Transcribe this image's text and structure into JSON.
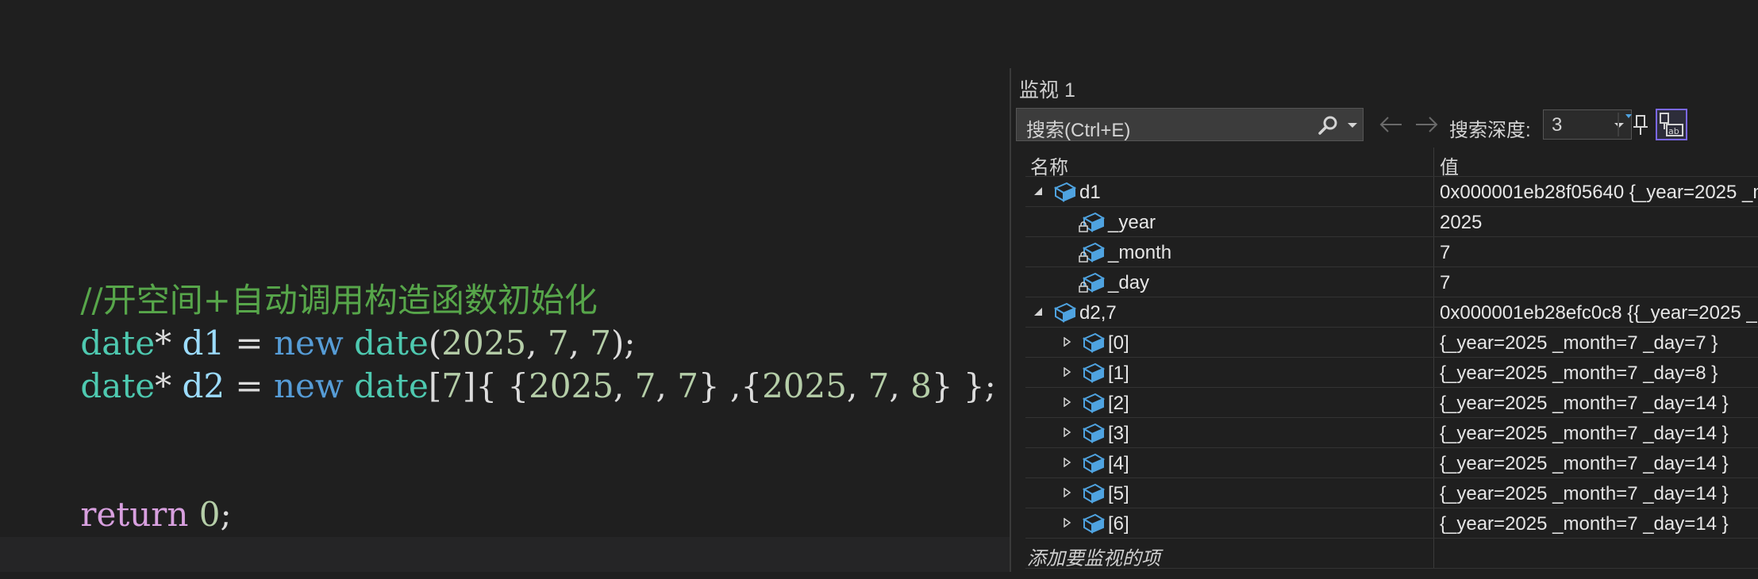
{
  "editor": {
    "line1": {
      "text": "//开空间+自动调用构造函数初始化"
    },
    "line2": {
      "t1": "date",
      "t2": "* ",
      "t3": "d1",
      "t4": " = ",
      "t5": "new",
      "t6": " ",
      "t7": "date",
      "t8": "(",
      "n1": "2025",
      "p1": ", ",
      "n2": "7",
      "p2": ", ",
      "n3": "7",
      "t9": ");"
    },
    "line3": {
      "t1": "date",
      "t2": "* ",
      "t3": "d2",
      "t4": " = ",
      "t5": "new",
      "t6": " ",
      "t7": "date",
      "t8": "[",
      "n0": "7",
      "t9": "]{ {",
      "n1": "2025",
      "p1": ", ",
      "n2": "7",
      "p2": ", ",
      "n3": "7",
      "t10": "} ,{",
      "n4": "2025",
      "p3": ", ",
      "n5": "7",
      "p4": ", ",
      "n6": "8",
      "t11": "} };"
    },
    "line4": {
      "kw": "return",
      "sp": " ",
      "num": "0",
      "end": ";"
    }
  },
  "watch": {
    "title": "监视 1",
    "search_placeholder": "搜索(Ctrl+E)",
    "depth_label": "搜索深度:",
    "depth_value": "3",
    "header_name": "名称",
    "header_value": "值",
    "rows": [
      {
        "name": "d1",
        "value": "0x000001eb28f05640 {_year=2025 _m"
      },
      {
        "name": "_year",
        "value": "2025"
      },
      {
        "name": "_month",
        "value": "7"
      },
      {
        "name": "_day",
        "value": "7"
      },
      {
        "name": "d2,7",
        "value": "0x000001eb28efc0c8 {{_year=2025 _"
      },
      {
        "name": "[0]",
        "value": "{_year=2025 _month=7 _day=7 }"
      },
      {
        "name": "[1]",
        "value": "{_year=2025 _month=7 _day=8 }"
      },
      {
        "name": "[2]",
        "value": "{_year=2025 _month=7 _day=14 }"
      },
      {
        "name": "[3]",
        "value": "{_year=2025 _month=7 _day=14 }"
      },
      {
        "name": "[4]",
        "value": "{_year=2025 _month=7 _day=14 }"
      },
      {
        "name": "[5]",
        "value": "{_year=2025 _month=7 _day=14 }"
      },
      {
        "name": "[6]",
        "value": "{_year=2025 _month=7 _day=14 }"
      }
    ],
    "add_item": "添加要监视的项"
  },
  "colors": {
    "comment": "#57a64a",
    "type": "#4ec9b0",
    "keyword": "#569cd6",
    "number": "#b5cea8",
    "return_kw": "#d8a0df",
    "object_icon": "#4fa3e0"
  },
  "icons": [
    "search-icon",
    "back-arrow-icon",
    "forward-arrow-icon",
    "pin-icon",
    "hex-display-icon",
    "object-icon",
    "lock-icon",
    "expand-icon",
    "collapse-icon"
  ]
}
